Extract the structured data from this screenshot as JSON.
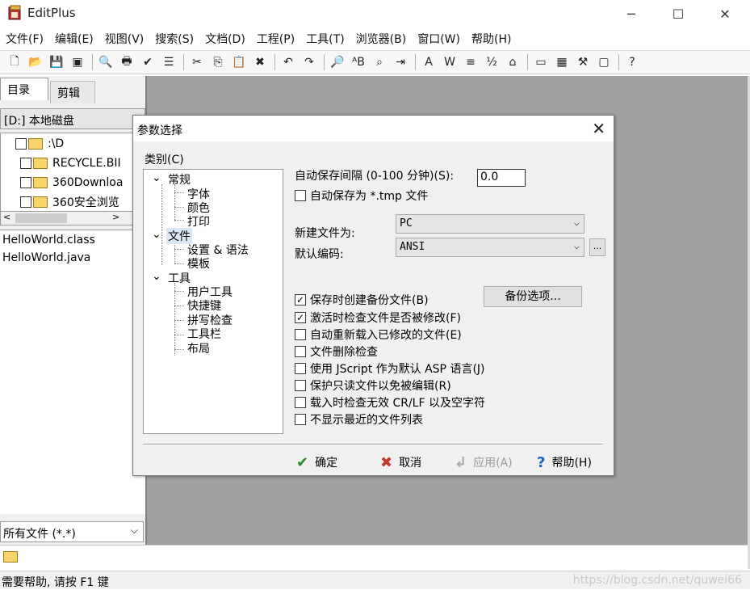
{
  "window": {
    "title": "EditPlus",
    "minimize": "─",
    "maximize": "☐",
    "close": "✕"
  },
  "menu": [
    "文件(F)",
    "编辑(E)",
    "视图(V)",
    "搜索(S)",
    "文档(D)",
    "工程(P)",
    "工具(T)",
    "浏览器(B)",
    "窗口(W)",
    "帮助(H)"
  ],
  "toolbar_icons": [
    "new-file-icon",
    "open-folder-icon",
    "save-icon",
    "save-all-icon",
    "sep",
    "print-preview-icon",
    "print-icon",
    "spell-check-icon",
    "page-setup-icon",
    "sep",
    "cut-icon",
    "copy-icon",
    "paste-icon",
    "delete-icon",
    "sep",
    "undo-icon",
    "redo-icon",
    "sep",
    "find-icon",
    "replace-icon",
    "find-in-files-icon",
    "goto-icon",
    "sep",
    "font-icon",
    "word-wrap-icon",
    "indent-icon",
    "line-number-icon",
    "preferences-icon",
    "sep",
    "ruler-icon",
    "hex-icon",
    "tool-icon",
    "template-icon",
    "sep",
    "help-icon"
  ],
  "toolbar_glyphs": [
    "🗋",
    "📂",
    "💾",
    "▣",
    "",
    "🔍",
    "🖶",
    "✔",
    "☰",
    "",
    "✂",
    "⎘",
    "📋",
    "✖",
    "",
    "↶",
    "↷",
    "",
    "🔎",
    "ᴬB",
    "⌕",
    "⇥",
    "",
    "A",
    "W",
    "≡",
    "½",
    "⌂",
    "",
    "▭",
    "▦",
    "⚒",
    "▢",
    "",
    "?"
  ],
  "left_panel": {
    "tabs": [
      "目录",
      "剪辑"
    ],
    "drive": "[D:] 本地磁盘",
    "tree": [
      ":\\D",
      "RECYCLE.BII",
      "360Downloa",
      "360安全浏览"
    ],
    "files": [
      "HelloWorld.class",
      "HelloWorld.java"
    ],
    "filter": "所有文件 (*.*)"
  },
  "status": {
    "text": "需要帮助, 请按 F1 键",
    "watermark": "https://blog.csdn.net/quwei66"
  },
  "dialog": {
    "title": "参数选择",
    "close": "✕",
    "category_label": "类别(C)",
    "categories": {
      "general": "常规",
      "font": "字体",
      "color": "颜色",
      "print": "打印",
      "file": "文件",
      "settings_syntax": "设置 & 语法",
      "template": "模板",
      "tools": "工具",
      "user_tools": "用户工具",
      "shortcut": "快捷键",
      "spell_check": "拼写检查",
      "toolbar": "工具栏",
      "layout": "布局"
    },
    "autosave_label": "自动保存间隔 (0-100 分钟)(S):",
    "autosave_value": "0.0",
    "autosave_tmp_label": "自动保存为 *.tmp 文件",
    "new_file_label": "新建文件为:",
    "new_file_value": "PC",
    "encoding_label": "默认编码:",
    "encoding_value": "ANSI",
    "encoding_more": "...",
    "backup_options_button": "备份选项...",
    "options": [
      {
        "label": "保存时创建备份文件(B)",
        "checked": true
      },
      {
        "label": "激活时检查文件是否被修改(F)",
        "checked": true
      },
      {
        "label": "自动重新载入已修改的文件(E)",
        "checked": false
      },
      {
        "label": "文件删除检查",
        "checked": false
      },
      {
        "label": "使用 JScript 作为默认 ASP 语言(J)",
        "checked": false
      },
      {
        "label": "保护只读文件以免被编辑(R)",
        "checked": false
      },
      {
        "label": "载入时检查无效 CR/LF 以及空字符",
        "checked": false
      },
      {
        "label": "不显示最近的文件列表",
        "checked": false
      }
    ],
    "buttons": {
      "ok": "确定",
      "cancel": "取消",
      "apply": "应用(A)",
      "help": "帮助(H)"
    },
    "colors": {
      "ok_icon": "#2e8b2e",
      "cancel_icon": "#c0392b",
      "help_icon": "#1f5fbf"
    }
  }
}
